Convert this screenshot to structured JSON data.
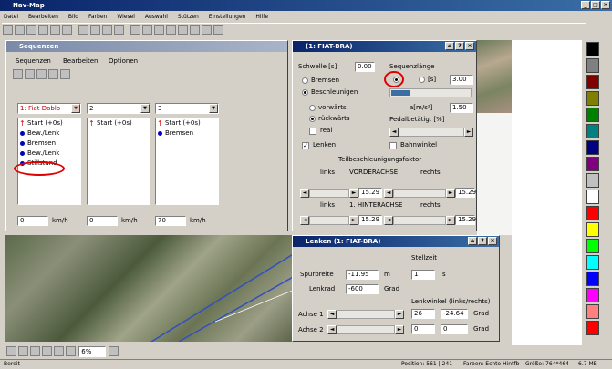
{
  "app": {
    "title": "Nav-Map",
    "window_buttons": [
      "_",
      "□",
      "×"
    ]
  },
  "menu": [
    "Datei",
    "Bearbeiten",
    "Bild",
    "Farben",
    "Wiesel",
    "Auswahl",
    "Stützen",
    "Einstellungen",
    "Hilfe"
  ],
  "sequences_window": {
    "title": "Sequenzen",
    "menu": [
      "Sequenzen",
      "Bearbeiten",
      "Optionen"
    ],
    "columns": [
      {
        "combo": "1: Fiat Doblo",
        "items": [
          {
            "icon": "arrow",
            "label": "Start (+0s)"
          },
          {
            "icon": "dot",
            "label": "Bew./Lenk"
          },
          {
            "icon": "dot",
            "label": "Bremsen"
          },
          {
            "icon": "dot",
            "label": "Bew./Lenk"
          },
          {
            "icon": "dot",
            "label": "Stillstand"
          }
        ],
        "speed": "0",
        "unit": "km/h"
      },
      {
        "combo": "2",
        "items": [
          {
            "icon": "arrow",
            "label": "Start (+0s)"
          }
        ],
        "speed": "0",
        "unit": "km/h"
      },
      {
        "combo": "3",
        "items": [
          {
            "icon": "arrow",
            "label": "Start (+0s)"
          },
          {
            "icon": "dot",
            "label": "Bremsen"
          }
        ],
        "speed": "70",
        "unit": "km/h"
      }
    ]
  },
  "motion_window": {
    "title": "(1: FIAT-BRA)",
    "schwelle_label": "Schwelle [s]",
    "schwelle_value": "0.00",
    "seq_label": "Sequenzlänge",
    "seq_value": "3.00",
    "seq_unit": "[s]",
    "bremsen": "Bremsen",
    "beschleunigen": "Beschleunigen",
    "vorwaerts": "vorwärts",
    "rueckwaerts": "rückwärts",
    "real": "real",
    "pedal_label": "Pedalbetätig. [%]",
    "rate_label": "a[m/s²]",
    "rate_value": "1.50",
    "lenken": "Lenken",
    "bahn": "Bahnwinkel",
    "brake_section": "Teilbeschleunigungsfaktor",
    "front_left": "links",
    "front_title": "VORDERACHSE",
    "front_right": "rechts",
    "front_vals": [
      "15.29",
      "15.29"
    ],
    "rear_left": "links",
    "rear_title": "1. HINTERACHSE",
    "rear_right": "rechts",
    "rear_vals": [
      "15.29",
      "15.29"
    ],
    "right_val": "15.29"
  },
  "steer_window": {
    "title": "Lenken (1: FIAT-BRA)",
    "spur_label": "Spurbreite",
    "spur_value": "-11.95",
    "spur_unit": "m",
    "lenk_label": "Lenkrad",
    "lenk_value": "-600",
    "lenk_unit": "Grad",
    "dauer_label": "Stellzeit",
    "dauer_value": "1",
    "dauer_unit": "s",
    "axle_header": "Lenkwinkel (links/rechts)",
    "axle1_label": "Achse 1",
    "axle1_vals": [
      "26",
      "-24.64"
    ],
    "axle_unit": "Grad",
    "axle2_label": "Achse 2",
    "axle2_vals": [
      "0",
      "0"
    ]
  },
  "zoom": "6%",
  "status": {
    "left": "Bereit",
    "cells": [
      "Position: 561 | 241",
      "Farben: Echte Hintfb",
      "Größe: 764*464",
      "6.7 MB"
    ]
  },
  "palette": [
    "#000000",
    "#808080",
    "#800000",
    "#808000",
    "#008000",
    "#008080",
    "#000080",
    "#800080",
    "#c0c0c0",
    "#ffffff",
    "#ff0000",
    "#ffff00",
    "#00ff00",
    "#00ffff",
    "#0000ff",
    "#ff00ff",
    "#ff8080",
    "#ff0000"
  ],
  "colors": {
    "title_active": "#0a246a",
    "title_end": "#3a6ea5",
    "highlight": "#e00000",
    "route": "#3050c0"
  }
}
